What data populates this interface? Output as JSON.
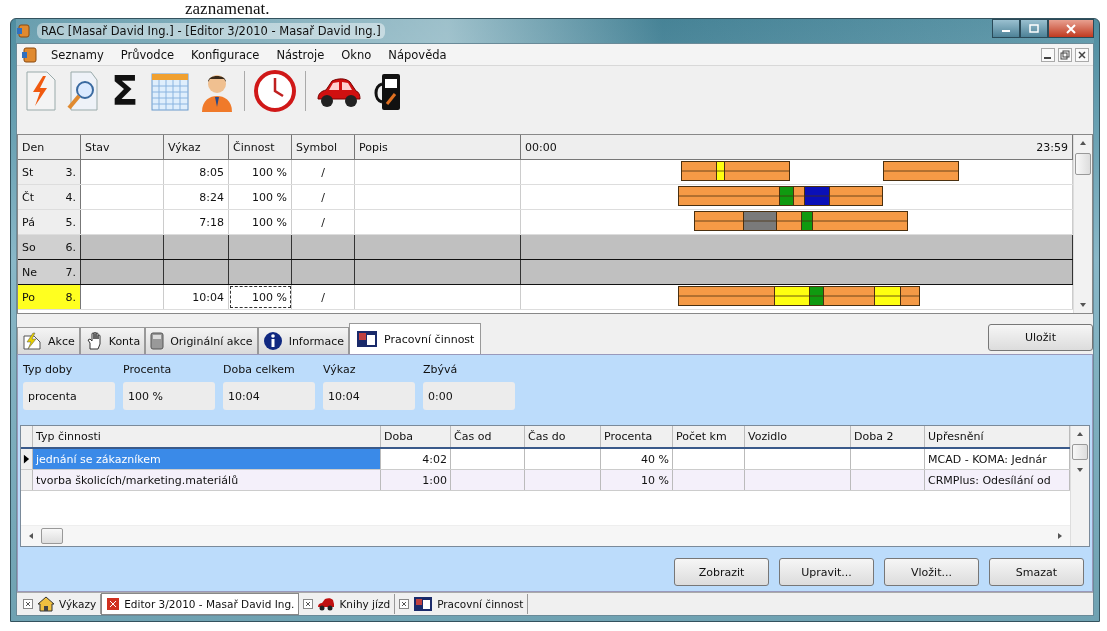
{
  "document_text": "zaznamenat.",
  "window": {
    "title": "RAC [Masař David Ing.] - [Editor 3/2010 - Masař David Ing.]"
  },
  "menu": [
    {
      "label": "Seznamy"
    },
    {
      "label": "Průvodce"
    },
    {
      "label": "Konfigurace"
    },
    {
      "label": "Nástroje"
    },
    {
      "label": "Okno"
    },
    {
      "label": "Nápověda"
    }
  ],
  "toolbar": {
    "sum_symbol": "Σ"
  },
  "grid": {
    "columns": [
      "Den",
      "Stav",
      "Výkaz",
      "Činnost",
      "Symbol",
      "Popis"
    ],
    "timeline_start": "00:00",
    "timeline_end": "23:59",
    "rows": [
      {
        "kind": "workday",
        "day": "St",
        "date": "3.",
        "highlighted": false,
        "report": "8:05",
        "activity": "100 %",
        "symbol": "/",
        "focused": false
      },
      {
        "kind": "workday",
        "day": "Čt",
        "date": "4.",
        "highlighted": false,
        "report": "8:24",
        "activity": "100 %",
        "symbol": "/",
        "focused": false
      },
      {
        "kind": "workday",
        "day": "Pá",
        "date": "5.",
        "highlighted": false,
        "report": "7:18",
        "activity": "100 %",
        "symbol": "/",
        "focused": false
      },
      {
        "kind": "weekend",
        "day": "So",
        "date": "6.",
        "highlighted": false
      },
      {
        "kind": "weekend",
        "day": "Ne",
        "date": "7.",
        "highlighted": false
      },
      {
        "kind": "workday",
        "day": "Po",
        "date": "8.",
        "highlighted": true,
        "report": "10:04",
        "activity": "100 %",
        "symbol": "/",
        "focused": true
      }
    ]
  },
  "tabs": [
    {
      "label": "Akce",
      "selected": false
    },
    {
      "label": "Konta",
      "selected": false
    },
    {
      "label": "Originální akce",
      "selected": false
    },
    {
      "label": "Informace",
      "selected": false
    },
    {
      "label": "Pracovní činnost",
      "selected": true
    }
  ],
  "save_button": "Uložit",
  "summary": [
    {
      "label": "Typ doby",
      "value": "procenta"
    },
    {
      "label": "Procenta",
      "value": "100 %"
    },
    {
      "label": "Doba celkem",
      "value": "10:04"
    },
    {
      "label": "Výkaz",
      "value": "10:04"
    },
    {
      "label": "Zbývá",
      "value": "0:00"
    }
  ],
  "activities": {
    "columns": [
      "Typ činnosti",
      "Doba",
      "Čas od",
      "Čas do",
      "Procenta",
      "Počet km",
      "Vozidlo",
      "Doba 2",
      "Upřesnění"
    ],
    "rows": [
      {
        "selected": true,
        "type": "jednání se zákazníkem",
        "duration": "4:02",
        "percent": "40 %",
        "detail": "MCAD - KOMA: Jednár"
      },
      {
        "selected": false,
        "type": "tvorba školicích/marketing.materiálů",
        "duration": "1:00",
        "percent": "10 %",
        "detail": "CRMPlus: Odesílání od"
      }
    ]
  },
  "buttons": [
    "Zobrazit",
    "Upravit...",
    "Vložit...",
    "Smazat"
  ],
  "document_tabs": [
    {
      "label": "Výkazy",
      "selected": false
    },
    {
      "label": "Editor 3/2010 - Masař David Ing.",
      "selected": true
    },
    {
      "label": "Knihy jízd",
      "selected": false
    },
    {
      "label": "Pracovní činnost",
      "selected": false
    }
  ]
}
